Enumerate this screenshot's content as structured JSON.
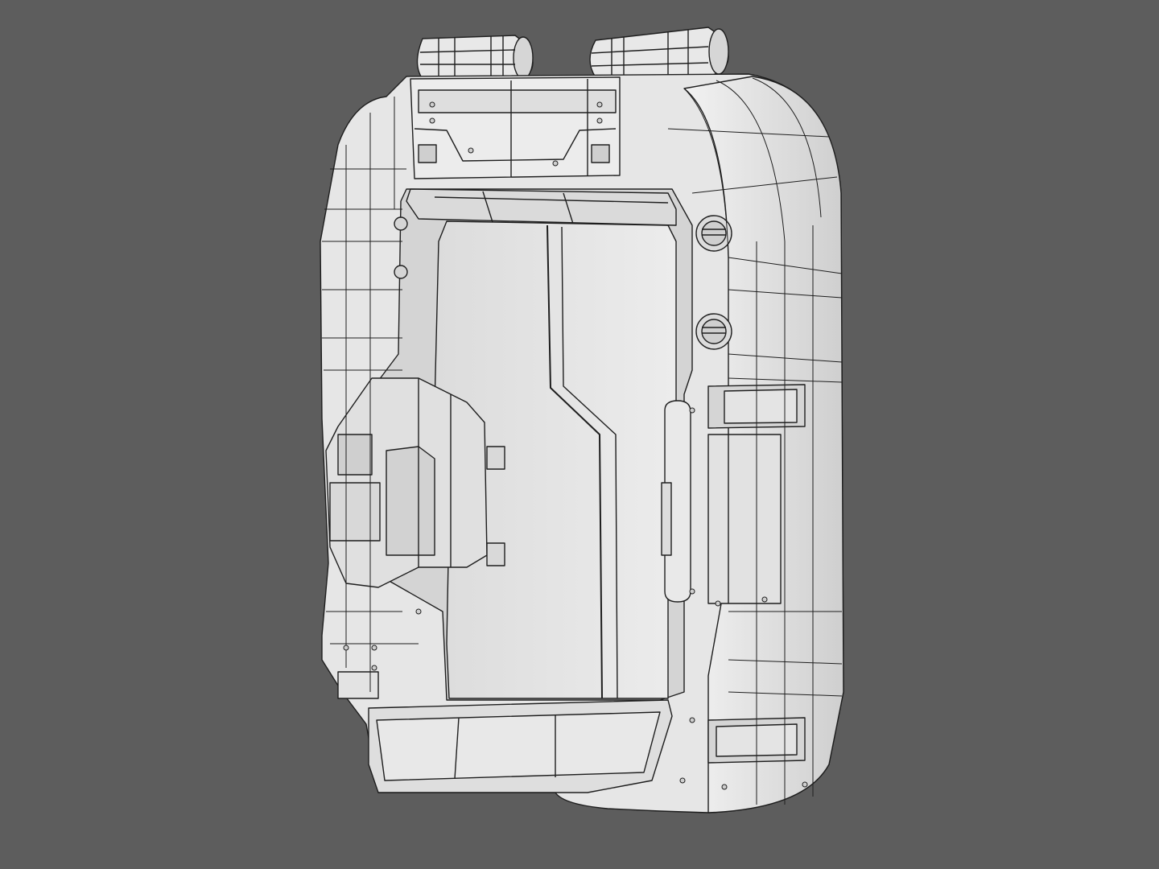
{
  "scene": {
    "background_color": "#5d5d5d",
    "model_base_color": "#e4e4e4",
    "model_shadow_color": "#c9c9c9",
    "wireframe_color": "#1e1e1e",
    "subject": "sci-fi-door-wireframe-icon"
  }
}
